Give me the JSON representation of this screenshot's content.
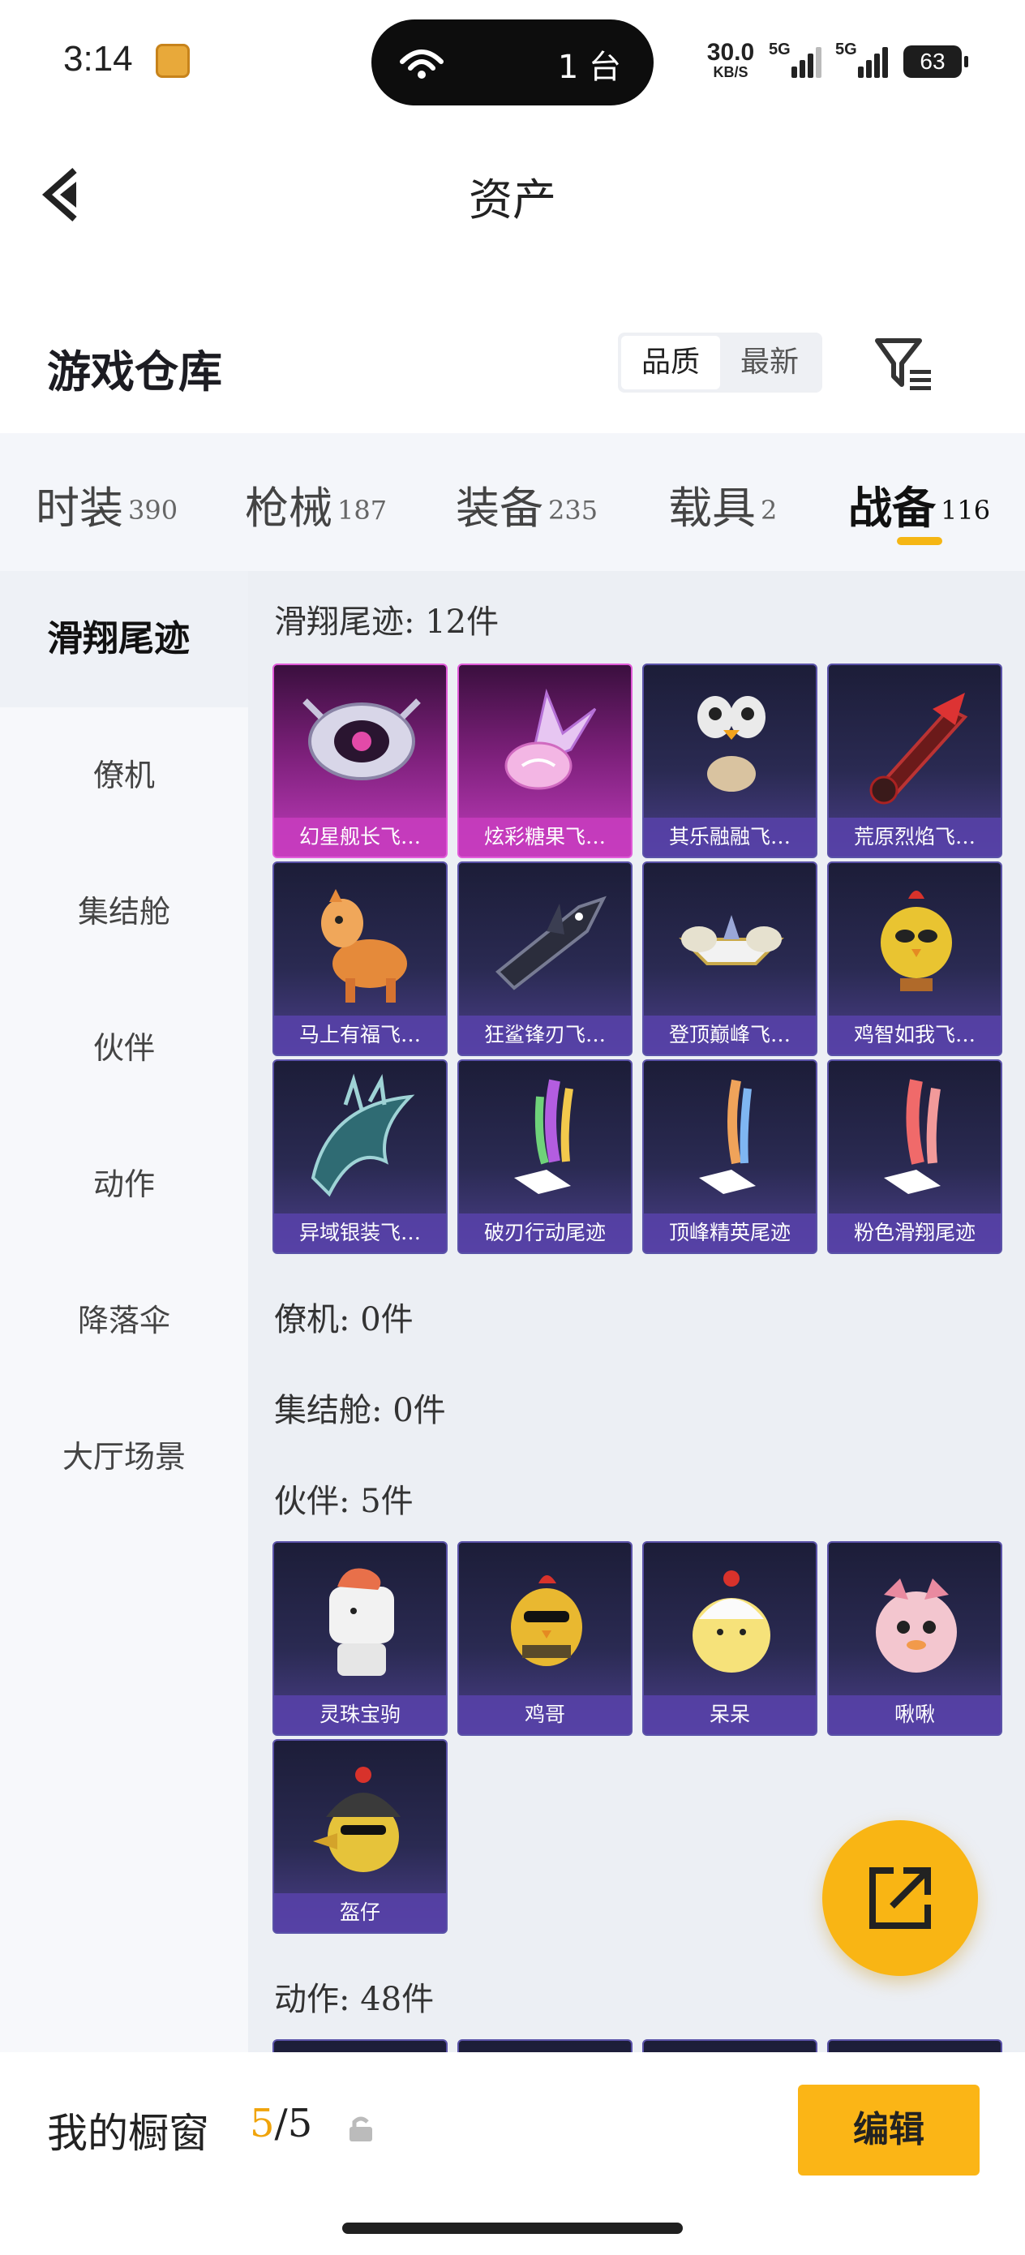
{
  "status_bar": {
    "time": "3:14",
    "hotspot_count": "1 台",
    "net_speed_value": "30.0",
    "net_speed_unit": "KB/S",
    "signal1_label": "5G",
    "signal2_label": "5G",
    "battery": "63"
  },
  "navbar": {
    "title": "资产"
  },
  "warehouse": {
    "title": "游戏仓库",
    "sort_options": [
      "品质",
      "最新"
    ],
    "sort_selected": "品质"
  },
  "tabs": [
    {
      "name": "时装",
      "count": "390"
    },
    {
      "name": "枪械",
      "count": "187"
    },
    {
      "name": "装备",
      "count": "235"
    },
    {
      "name": "载具",
      "count": "2"
    },
    {
      "name": "战备",
      "count": "116",
      "active": true
    }
  ],
  "sidebar": {
    "items": [
      "滑翔尾迹",
      "僚机",
      "集结舱",
      "伙伴",
      "动作",
      "降落伞",
      "大厅场景"
    ],
    "active": "滑翔尾迹"
  },
  "sections": {
    "glide": {
      "heading": "滑翔尾迹: 12件",
      "items": [
        {
          "name": "幻星舰长飞…",
          "rarity": "pink",
          "icon": "eye-glider-icon"
        },
        {
          "name": "炫彩糖果飞…",
          "rarity": "pink",
          "icon": "candy-glider-icon"
        },
        {
          "name": "其乐融融飞…",
          "rarity": "purple",
          "icon": "penguin-glider-icon"
        },
        {
          "name": "荒原烈焰飞…",
          "rarity": "purple",
          "icon": "flame-glider-icon"
        },
        {
          "name": "马上有福飞…",
          "rarity": "purple",
          "icon": "horse-glider-icon"
        },
        {
          "name": "狂鲨锋刃飞…",
          "rarity": "purple",
          "icon": "shark-glider-icon"
        },
        {
          "name": "登顶巅峰飞…",
          "rarity": "purple",
          "icon": "jet-glider-icon"
        },
        {
          "name": "鸡智如我飞…",
          "rarity": "purple",
          "icon": "chicken-glider-icon"
        },
        {
          "name": "异域银装飞…",
          "rarity": "purple",
          "icon": "wing-glider-icon"
        },
        {
          "name": "破刃行动尾迹",
          "rarity": "purple",
          "icon": "rainbow-trail-icon"
        },
        {
          "name": "顶峰精英尾迹",
          "rarity": "purple",
          "icon": "smoke-trail-icon"
        },
        {
          "name": "粉色滑翔尾迹",
          "rarity": "purple",
          "icon": "pink-trail-icon"
        }
      ]
    },
    "wingman": {
      "heading": "僚机: 0件"
    },
    "pod": {
      "heading": "集结舱: 0件"
    },
    "buddy": {
      "heading": "伙伴: 5件",
      "items": [
        {
          "name": "灵珠宝驹",
          "icon": "pony-buddy-icon"
        },
        {
          "name": "鸡哥",
          "icon": "chicken-buddy-icon"
        },
        {
          "name": "呆呆",
          "icon": "chick-buddy-icon"
        },
        {
          "name": "啾啾",
          "icon": "bird-buddy-icon"
        },
        {
          "name": "盔仔",
          "icon": "helmet-buddy-icon"
        }
      ]
    },
    "emote": {
      "heading": "动作: 48件"
    }
  },
  "showcase": {
    "label": "我的橱窗",
    "current": "5",
    "total": "/5",
    "edit_label": "编辑"
  },
  "colors": {
    "accent": "#fbb516",
    "rare_pink": "#c03cbc",
    "rare_purple": "#4b3f8a"
  }
}
